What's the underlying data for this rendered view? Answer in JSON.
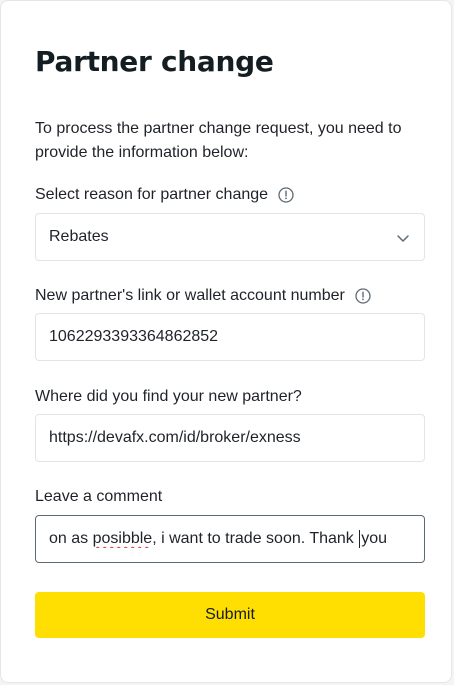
{
  "form": {
    "title": "Partner change",
    "intro": "To process the partner change request, you need to provide the information below:",
    "reason": {
      "label": "Select reason for partner change",
      "value": "Rebates"
    },
    "partner_link": {
      "label": "New partner's link or wallet account number",
      "value": "1062293393364862852"
    },
    "source": {
      "label": "Where did you find your new partner?",
      "value": "https://devafx.com/id/broker/exness"
    },
    "comment": {
      "label": "Leave a comment",
      "value_part1": "on as ",
      "value_misspelled": "posibble",
      "value_part2": ", i want to trade soon. Thank ",
      "value_part3": "you"
    },
    "submit_label": "Submit"
  },
  "icons": {
    "info": "info-circle-icon",
    "chevron": "chevron-down-icon"
  },
  "colors": {
    "accent": "#ffde02",
    "text": "#1f2329",
    "border": "#e3e4e6",
    "spell_error": "#e03030"
  }
}
